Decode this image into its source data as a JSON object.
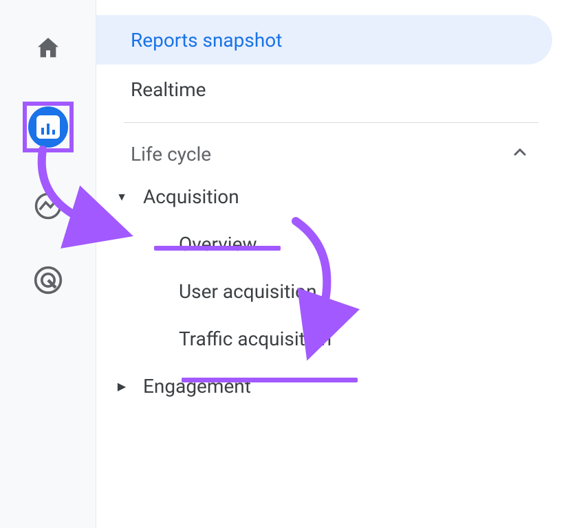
{
  "nav": {
    "reports_snapshot": "Reports snapshot",
    "realtime": "Realtime",
    "life_cycle": "Life cycle",
    "acquisition": "Acquisition",
    "overview": "Overview",
    "user_acquisition": "User acquisition",
    "traffic_acquisition": "Traffic acquisition",
    "engagement": "Engagement"
  },
  "icons": {
    "home": "home-icon",
    "reports": "reports-icon",
    "explore": "explore-icon",
    "advertising": "advertising-icon",
    "chevron_up": "chevron-up-icon",
    "caret_down": "caret-down-icon",
    "caret_right": "caret-right-icon"
  },
  "annotation_color": "#a259ff",
  "brand_blue": "#1a73e8"
}
